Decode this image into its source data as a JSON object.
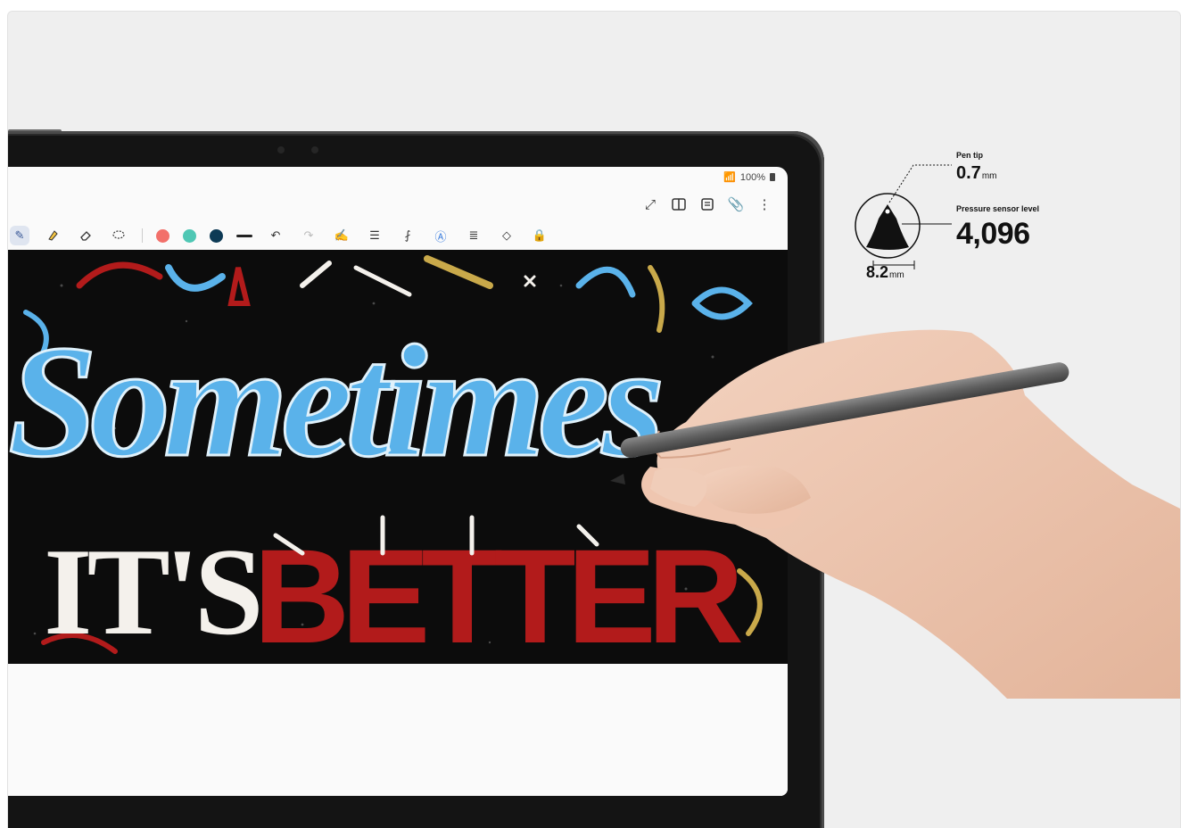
{
  "status_bar": {
    "icons": [
      "wifi-icon",
      "signal-icon"
    ],
    "battery": "100%"
  },
  "top_toolbar": {
    "icons": [
      "expand-icon",
      "book-view-icon",
      "notes-icon",
      "attach-icon",
      "more-options-icon"
    ]
  },
  "drawing_toolbar": {
    "tools": [
      "pen-icon",
      "highlighter-icon",
      "eraser-icon",
      "lasso-icon"
    ],
    "colors": [
      "#f2706a",
      "#4fc7b4",
      "#0d3a55"
    ],
    "actions": [
      "undo-icon",
      "redo-icon",
      "shape-pen-icon",
      "text-align-icon",
      "handwriting-to-text-icon",
      "text-style-icon",
      "text-box-icon",
      "shapes-icon",
      "lock-icon"
    ]
  },
  "artwork": {
    "line1": "Sometimes",
    "line2_left": "IT'S",
    "line2_right": "BETTER"
  },
  "specs": {
    "pen_tip_label": "Pen tip",
    "pen_tip_value": "0.7",
    "pen_tip_unit": "mm",
    "pressure_label": "Pressure sensor level",
    "pressure_value": "4,096",
    "width_value": "8.2",
    "width_unit": "mm"
  },
  "colors": {
    "background": "#efefef",
    "tablet_bezel": "#141414",
    "artwork_blue": "#5ab2ea",
    "artwork_red": "#b21b1b",
    "artwork_white": "#f4f1ec",
    "artwork_gold": "#c9a94a"
  }
}
